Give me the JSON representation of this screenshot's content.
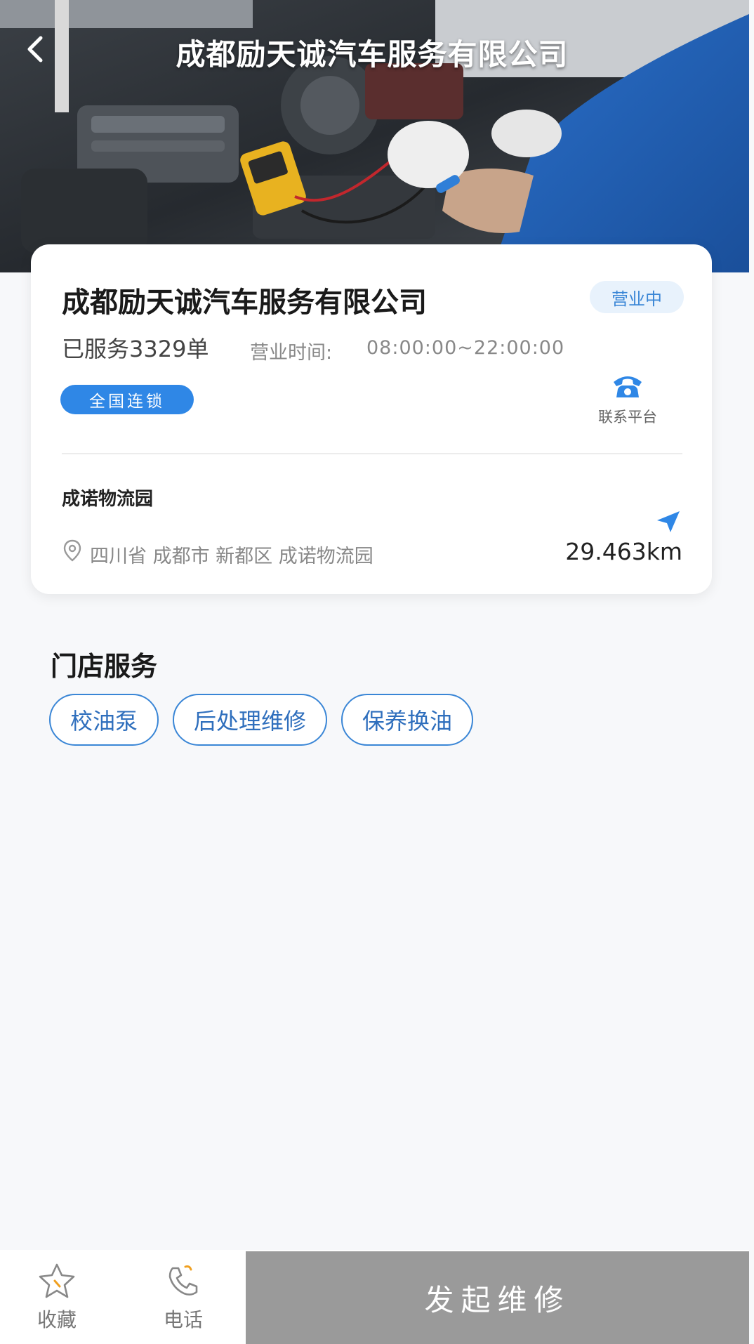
{
  "header": {
    "title": "成都励天诚汽车服务有限公司",
    "back_icon": "chevron-left-icon"
  },
  "store": {
    "name": "成都励天诚汽车服务有限公司",
    "status": "营业中",
    "served": "已服务3329单",
    "hours_label": "营业时间:",
    "hours": "08:00:00~22:00:00",
    "chain_tag": "全国连锁",
    "contact_label": "联系平台",
    "park_name": "成诺物流园",
    "address": "四川省 成都市 新都区 成诺物流园",
    "distance": "29.463km",
    "colors": {
      "accent": "#2f87e6",
      "badge_bg": "#e8f2fc"
    }
  },
  "services": {
    "title": "门店服务",
    "tags": [
      "校油泵",
      "后处理维修",
      "保养换油"
    ]
  },
  "bottom": {
    "favorite_label": "收藏",
    "phone_label": "电话",
    "repair_button": "发起维修"
  }
}
